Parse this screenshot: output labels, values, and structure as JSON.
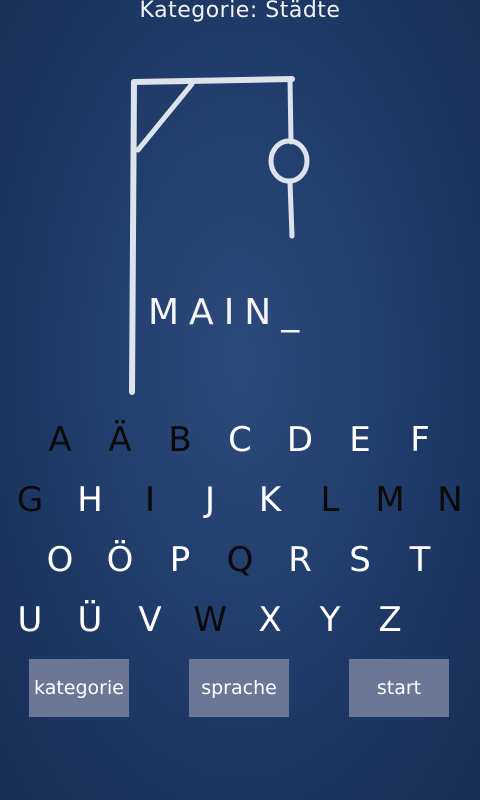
{
  "header": {
    "category_label": "Kategorie: Städte"
  },
  "game": {
    "word_display": "MAIN_"
  },
  "keyboard": {
    "rows": [
      [
        {
          "l": "A",
          "used": true
        },
        {
          "l": "Ä",
          "used": true
        },
        {
          "l": "B",
          "used": true
        },
        {
          "l": "C",
          "used": false
        },
        {
          "l": "D",
          "used": false
        },
        {
          "l": "E",
          "used": false
        },
        {
          "l": "F",
          "used": false
        }
      ],
      [
        {
          "l": "G",
          "used": true
        },
        {
          "l": "H",
          "used": false
        },
        {
          "l": "I",
          "used": true
        },
        {
          "l": "J",
          "used": false
        },
        {
          "l": "K",
          "used": false
        },
        {
          "l": "L",
          "used": true
        },
        {
          "l": "M",
          "used": true
        },
        {
          "l": "N",
          "used": true
        }
      ],
      [
        {
          "l": "O",
          "used": false
        },
        {
          "l": "Ö",
          "used": false
        },
        {
          "l": "P",
          "used": false
        },
        {
          "l": "Q",
          "used": true
        },
        {
          "l": "R",
          "used": false
        },
        {
          "l": "S",
          "used": false
        },
        {
          "l": "T",
          "used": false
        }
      ],
      [
        {
          "l": "U",
          "used": false
        },
        {
          "l": "Ü",
          "used": false
        },
        {
          "l": "V",
          "used": false
        },
        {
          "l": "W",
          "used": true
        },
        {
          "l": "X",
          "used": false
        },
        {
          "l": "Y",
          "used": false
        },
        {
          "l": "Z",
          "used": false
        }
      ]
    ]
  },
  "buttons": {
    "kategorie": "kategorie",
    "sprache": "sprache",
    "start": "start"
  },
  "colors": {
    "used_letter": "#0a0a0a",
    "free_letter": "#ffffff",
    "button_bg": "#6a7896"
  }
}
